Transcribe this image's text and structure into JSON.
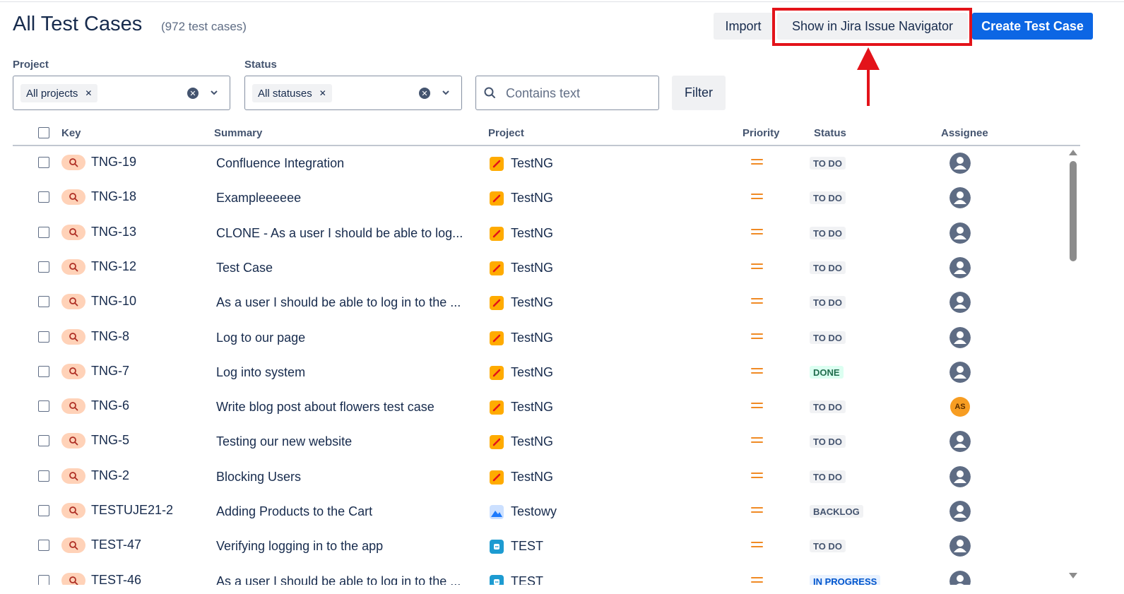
{
  "header": {
    "title": "All Test Cases",
    "count": "(972 test cases)",
    "import_label": "Import",
    "jira_nav_label": "Show in Jira Issue Navigator",
    "create_label": "Create Test Case",
    "accent_color": "#0c66e4",
    "annotation_color": "#e3131a"
  },
  "filters": {
    "project_label": "Project",
    "project_value": "All projects",
    "status_label": "Status",
    "status_value": "All statuses",
    "search_placeholder": "Contains text",
    "filter_button": "Filter"
  },
  "table": {
    "columns": [
      "Key",
      "Summary",
      "Project",
      "Priority",
      "Status",
      "Assignee"
    ],
    "rows": [
      {
        "key": "TNG-19",
        "summary": "Confluence Integration",
        "project": "TestNG",
        "project_icon": "pencil-icon",
        "status": "TO DO",
        "assignee": "default-avatar-icon"
      },
      {
        "key": "TNG-18",
        "summary": "Exampleeeeee",
        "project": "TestNG",
        "project_icon": "pencil-icon",
        "status": "TO DO",
        "assignee": "default-avatar-icon"
      },
      {
        "key": "TNG-13",
        "summary": "CLONE - As a user I should be able to log...",
        "project": "TestNG",
        "project_icon": "pencil-icon",
        "status": "TO DO",
        "assignee": "default-avatar-icon"
      },
      {
        "key": "TNG-12",
        "summary": "Test Case",
        "project": "TestNG",
        "project_icon": "pencil-icon",
        "status": "TO DO",
        "assignee": "default-avatar-icon"
      },
      {
        "key": "TNG-10",
        "summary": "As a user I should be able to log in to the ...",
        "project": "TestNG",
        "project_icon": "pencil-icon",
        "status": "TO DO",
        "assignee": "default-avatar-icon"
      },
      {
        "key": "TNG-8",
        "summary": "Log to our page",
        "project": "TestNG",
        "project_icon": "pencil-icon",
        "status": "TO DO",
        "assignee": "default-avatar-icon"
      },
      {
        "key": "TNG-7",
        "summary": "Log into system",
        "project": "TestNG",
        "project_icon": "pencil-icon",
        "status": "DONE",
        "assignee": "default-avatar-icon"
      },
      {
        "key": "TNG-6",
        "summary": "Write blog post about flowers test case",
        "project": "TestNG",
        "project_icon": "pencil-icon",
        "status": "TO DO",
        "assignee": "AS"
      },
      {
        "key": "TNG-5",
        "summary": "Testing our new website",
        "project": "TestNG",
        "project_icon": "pencil-icon",
        "status": "TO DO",
        "assignee": "default-avatar-icon"
      },
      {
        "key": "TNG-2",
        "summary": "Blocking Users",
        "project": "TestNG",
        "project_icon": "pencil-icon",
        "status": "TO DO",
        "assignee": "default-avatar-icon"
      },
      {
        "key": "TESTUJE21-2",
        "summary": "Adding Products to the Cart",
        "project": "Testowy",
        "project_icon": "mountain-image-icon",
        "status": "BACKLOG",
        "assignee": "default-avatar-icon"
      },
      {
        "key": "TEST-47",
        "summary": "Verifying logging in to the app",
        "project": "TEST",
        "project_icon": "robot-icon",
        "status": "TO DO",
        "assignee": "default-avatar-icon"
      },
      {
        "key": "TEST-46",
        "summary": "As a user I should be able to log in to the ...",
        "project": "TEST",
        "project_icon": "robot-icon",
        "status": "IN PROGRESS",
        "assignee": "default-avatar-icon"
      }
    ]
  },
  "colors": {
    "status_todo_bg": "#f1f2f4",
    "status_todo_fg": "#44546f",
    "status_done_bg": "#dcfff1",
    "status_done_fg": "#216e4e",
    "status_inprogress_bg": "#e9f2ff",
    "status_inprogress_fg": "#0055cc",
    "priority_medium": "#f08a24"
  }
}
